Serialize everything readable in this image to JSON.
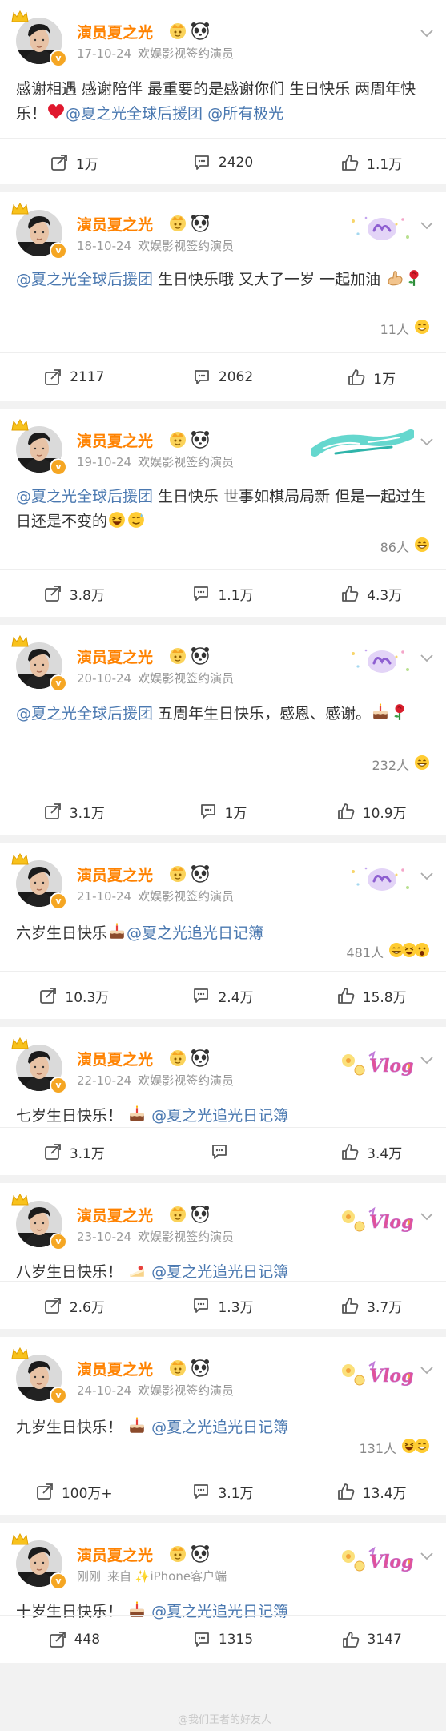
{
  "author": {
    "name": "演员夏之光",
    "subtitle": "欢娱影视签约演员"
  },
  "posts": [
    {
      "timestamp": "17-10-24",
      "content": [
        {
          "t": "text",
          "v": "感谢相遇 感谢陪伴 最重要的是感谢你们 生日快乐 两周年快乐！"
        },
        {
          "t": "emoji",
          "name": "red-heart"
        },
        {
          "t": "mention",
          "v": "@夏之光全球后援团"
        },
        {
          "t": "text",
          "v": " "
        },
        {
          "t": "mention",
          "v": "@所有极光"
        }
      ],
      "sticker": "none",
      "likes_summary": null,
      "actions": {
        "repost": "1万",
        "comment": "2420",
        "like": "1.1万"
      }
    },
    {
      "timestamp": "18-10-24",
      "content": [
        {
          "t": "mention",
          "v": "@夏之光全球后援团"
        },
        {
          "t": "text",
          "v": " 生日快乐哦 又大了一岁 一起加油 "
        },
        {
          "t": "emoji",
          "name": "muscle"
        },
        {
          "t": "emoji",
          "name": "rose"
        }
      ],
      "sticker": "sparkle-badge",
      "likes_summary": {
        "text": "11人",
        "emojis": [
          "grin"
        ]
      },
      "actions": {
        "repost": "2117",
        "comment": "2062",
        "like": "1万"
      }
    },
    {
      "timestamp": "19-10-24",
      "content": [
        {
          "t": "mention",
          "v": "@夏之光全球后援团"
        },
        {
          "t": "text",
          "v": " 生日快乐 世事如棋局局新 但是一起过生日还是不变的"
        },
        {
          "t": "emoji",
          "name": "laugh"
        },
        {
          "t": "emoji",
          "name": "sweat-smile"
        }
      ],
      "sticker": "teal-brush",
      "likes_summary": {
        "text": "86人",
        "emojis": [
          "grin"
        ]
      },
      "actions": {
        "repost": "3.8万",
        "comment": "1.1万",
        "like": "4.3万"
      }
    },
    {
      "timestamp": "20-10-24",
      "content": [
        {
          "t": "mention",
          "v": "@夏之光全球后援团"
        },
        {
          "t": "text",
          "v": " 五周年生日快乐，感恩、感谢。"
        },
        {
          "t": "emoji",
          "name": "cake"
        },
        {
          "t": "emoji",
          "name": "rose"
        }
      ],
      "sticker": "sparkle-badge",
      "likes_summary": {
        "text": "232人",
        "emojis": [
          "grin"
        ]
      },
      "actions": {
        "repost": "3.1万",
        "comment": "1万",
        "like": "10.9万"
      }
    },
    {
      "timestamp": "21-10-24",
      "content": [
        {
          "t": "text",
          "v": "六岁生日快乐"
        },
        {
          "t": "emoji",
          "name": "cake"
        },
        {
          "t": "mention",
          "v": "@夏之光追光日记簿"
        }
      ],
      "sticker": "sparkle-badge",
      "likes_summary": {
        "text": "481人",
        "emojis": [
          "grin",
          "laugh",
          "wow"
        ]
      },
      "actions": {
        "repost": "10.3万",
        "comment": "2.4万",
        "like": "15.8万"
      }
    },
    {
      "timestamp": "22-10-24",
      "content": [
        {
          "t": "text",
          "v": "七岁生日快乐！ "
        },
        {
          "t": "emoji",
          "name": "cake"
        },
        {
          "t": "mention",
          "v": " @夏之光追光日记簿"
        }
      ],
      "sticker": "vlog",
      "likes_summary": null,
      "actions": {
        "repost": "3.1万",
        "comment": "",
        "like": "3.4万"
      }
    },
    {
      "timestamp": "23-10-24",
      "content": [
        {
          "t": "text",
          "v": "八岁生日快乐！ "
        },
        {
          "t": "emoji",
          "name": "cake-slice"
        },
        {
          "t": "mention",
          "v": " @夏之光追光日记簿"
        }
      ],
      "sticker": "vlog",
      "likes_summary": null,
      "actions": {
        "repost": "2.6万",
        "comment": "1.3万",
        "like": "3.7万"
      }
    },
    {
      "timestamp": "24-10-24",
      "content": [
        {
          "t": "text",
          "v": "九岁生日快乐！ "
        },
        {
          "t": "emoji",
          "name": "cake"
        },
        {
          "t": "mention",
          "v": " @夏之光追光日记簿"
        }
      ],
      "sticker": "vlog",
      "likes_summary": {
        "text": "131人",
        "emojis": [
          "laugh",
          "grin"
        ]
      },
      "actions": {
        "repost": "100万+",
        "comment": "3.1万",
        "like": "13.4万"
      }
    },
    {
      "timestamp": "刚刚",
      "source": "来自 ✨iPhone客户端",
      "content": [
        {
          "t": "text",
          "v": "十岁生日快乐！ "
        },
        {
          "t": "emoji",
          "name": "cake"
        },
        {
          "t": "mention",
          "v": " @夏之光追光日记簿"
        }
      ],
      "sticker": "vlog",
      "likes_summary": null,
      "actions": {
        "repost": "448",
        "comment": "1315",
        "like": "3147"
      }
    }
  ],
  "watermark": "@我们王者的好友人",
  "colors": {
    "name": "#ff8200",
    "mention": "#4a78b0",
    "meta": "#999999",
    "separator": "#f2f2f2"
  }
}
